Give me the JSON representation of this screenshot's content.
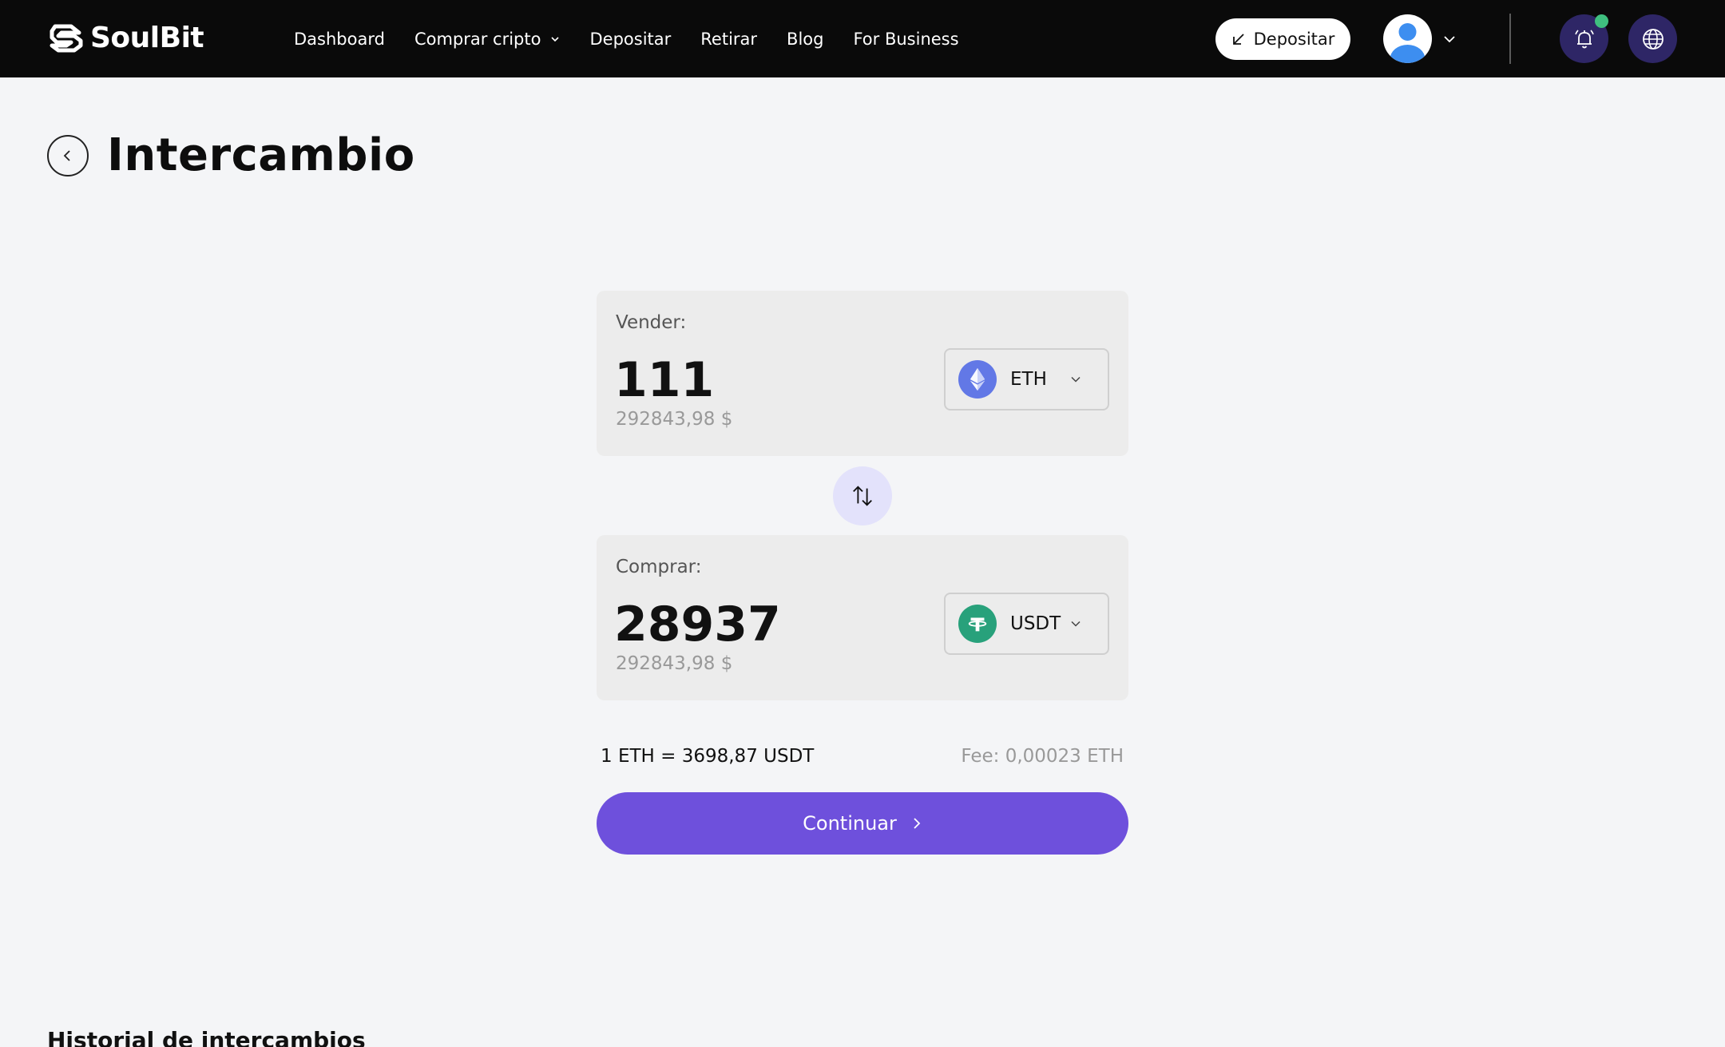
{
  "brand": {
    "name": "SoulBit"
  },
  "nav": {
    "links": [
      {
        "label": "Dashboard"
      },
      {
        "label": "Comprar cripto"
      },
      {
        "label": "Depositar"
      },
      {
        "label": "Retirar"
      },
      {
        "label": "Blog"
      },
      {
        "label": "For Business"
      }
    ],
    "deposit_button": "Depositar",
    "notification_unread": true
  },
  "page": {
    "title": "Intercambio",
    "history_title": "Historial de intercambios"
  },
  "swap": {
    "sell": {
      "label": "Vender:",
      "amount": "111",
      "usd_value": "292843,98 $",
      "coin": "ETH"
    },
    "buy": {
      "label": "Comprar:",
      "amount": "28937",
      "usd_value": "292843,98 $",
      "coin": "USDT"
    },
    "rate": "1 ETH = 3698,87 USDT",
    "fee": "Fee: 0,00023 ETH",
    "continue_label": "Continuar"
  },
  "colors": {
    "nav_bg": "#0a0a0a",
    "accent": "#6e50dc",
    "icon_circle": "#2e2666",
    "eth": "#6278e6",
    "usdt": "#28a17b",
    "notification_dot": "#3fbf7f"
  }
}
